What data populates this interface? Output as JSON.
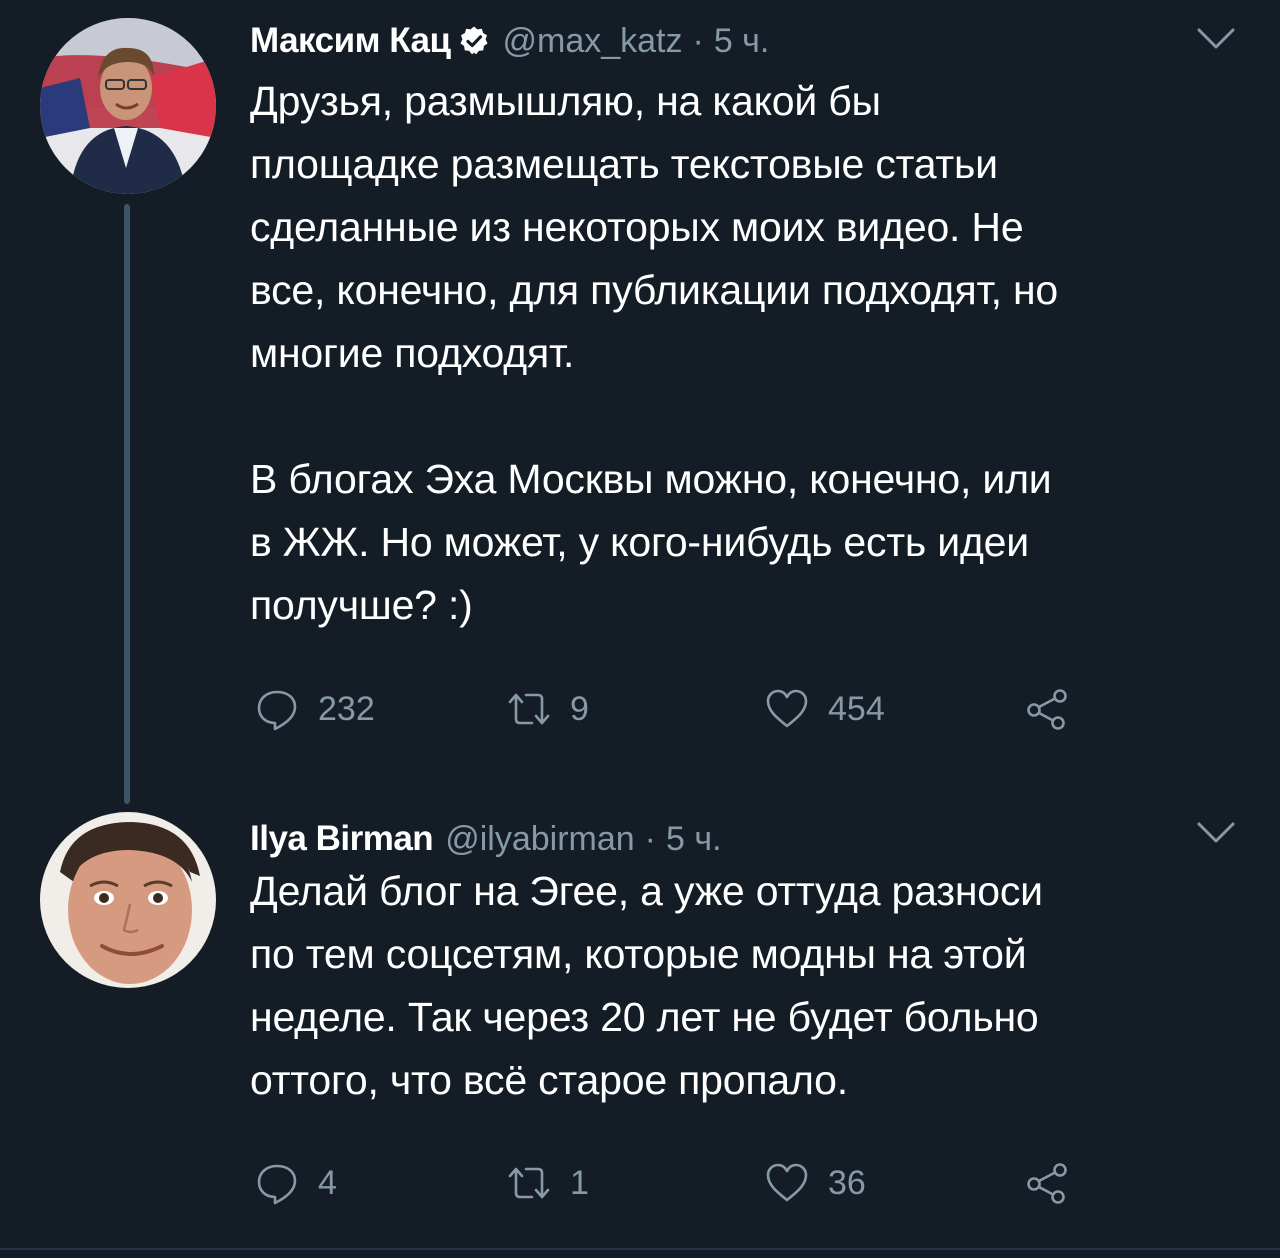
{
  "tweets": [
    {
      "author_name": "Максим Кац",
      "verified": true,
      "handle": "@max_katz",
      "separator": "·",
      "time": "5 ч.",
      "text": "Друзья, размышляю, на какой бы\nплощадке размещать текстовые статьи\nсделанные из некоторых моих видео. Не\nвсе, конечно, для публикации подходят, но\nмногие подходят.\n\nВ блогах Эха Москвы можно, конечно, или\nв ЖЖ. Но может, у кого-нибудь есть идеи\nполучше? :)",
      "replies": "232",
      "retweets": "9",
      "likes": "454"
    },
    {
      "author_name": "Ilya Birman",
      "verified": false,
      "handle": "@ilyabirman",
      "separator": "·",
      "time": "5 ч.",
      "text": "Делай блог на Эгее, а уже оттуда разноси\nпо тем соцсетям, которые модны на этой\nнеделе. Так через 20 лет не будет больно\nоттого, что всё старое пропало.",
      "replies": "4",
      "retweets": "1",
      "likes": "36"
    }
  ],
  "icons": {
    "reply": "reply-icon",
    "retweet": "retweet-icon",
    "like": "heart-icon",
    "share": "share-icon",
    "menu": "chevron-down-icon",
    "verified": "verified-badge-icon"
  },
  "colors": {
    "background": "#141d26",
    "text": "#ffffff",
    "secondary": "#8899a6",
    "thread_line": "#3d5466"
  }
}
